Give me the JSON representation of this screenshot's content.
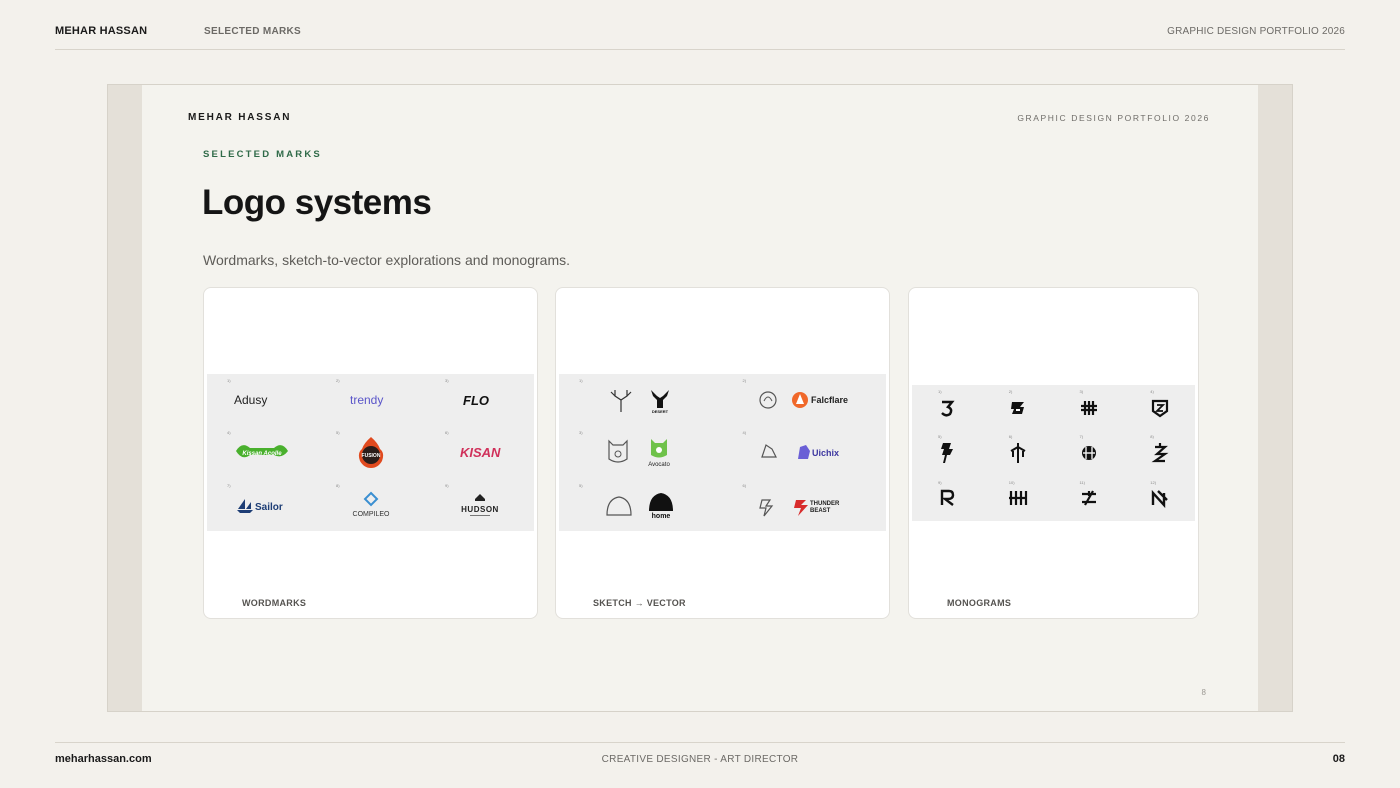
{
  "header": {
    "brand": "MEHAR HASSAN",
    "section": "SELECTED MARKS",
    "portfolio": "GRAPHIC DESIGN PORTFOLIO 2026"
  },
  "slide": {
    "brand": "MEHAR HASSAN",
    "portfolio": "GRAPHIC DESIGN PORTFOLIO 2026",
    "kicker": "SELECTED MARKS",
    "title": "Logo systems",
    "subtitle": "Wordmarks, sketch-to-vector explorations and monograms.",
    "page_number": "8",
    "cards": [
      {
        "caption": "WORDMARKS",
        "logos": [
          "Adusy",
          "trendy",
          "FLO",
          "Kissan Acolle",
          "FUSION",
          "KISAN",
          "Sailor",
          "COMPILEO",
          "HUDSON"
        ]
      },
      {
        "caption": "SKETCH → VECTOR",
        "logos": [
          "DESERT",
          "Falcflare",
          "Avocato",
          "Uichix",
          "home",
          "THUNDER",
          "BEAST"
        ]
      },
      {
        "caption": "MONOGRAMS"
      }
    ]
  },
  "footer": {
    "site": "meharhassan.com",
    "role": "CREATIVE DESIGNER - ART DIRECTOR",
    "page": "08"
  },
  "colors": {
    "background": "#f3f1ec",
    "slide": "#f4f3ee",
    "kicker": "#2f6a48",
    "text": "#151515",
    "muted": "#6c6a66"
  }
}
